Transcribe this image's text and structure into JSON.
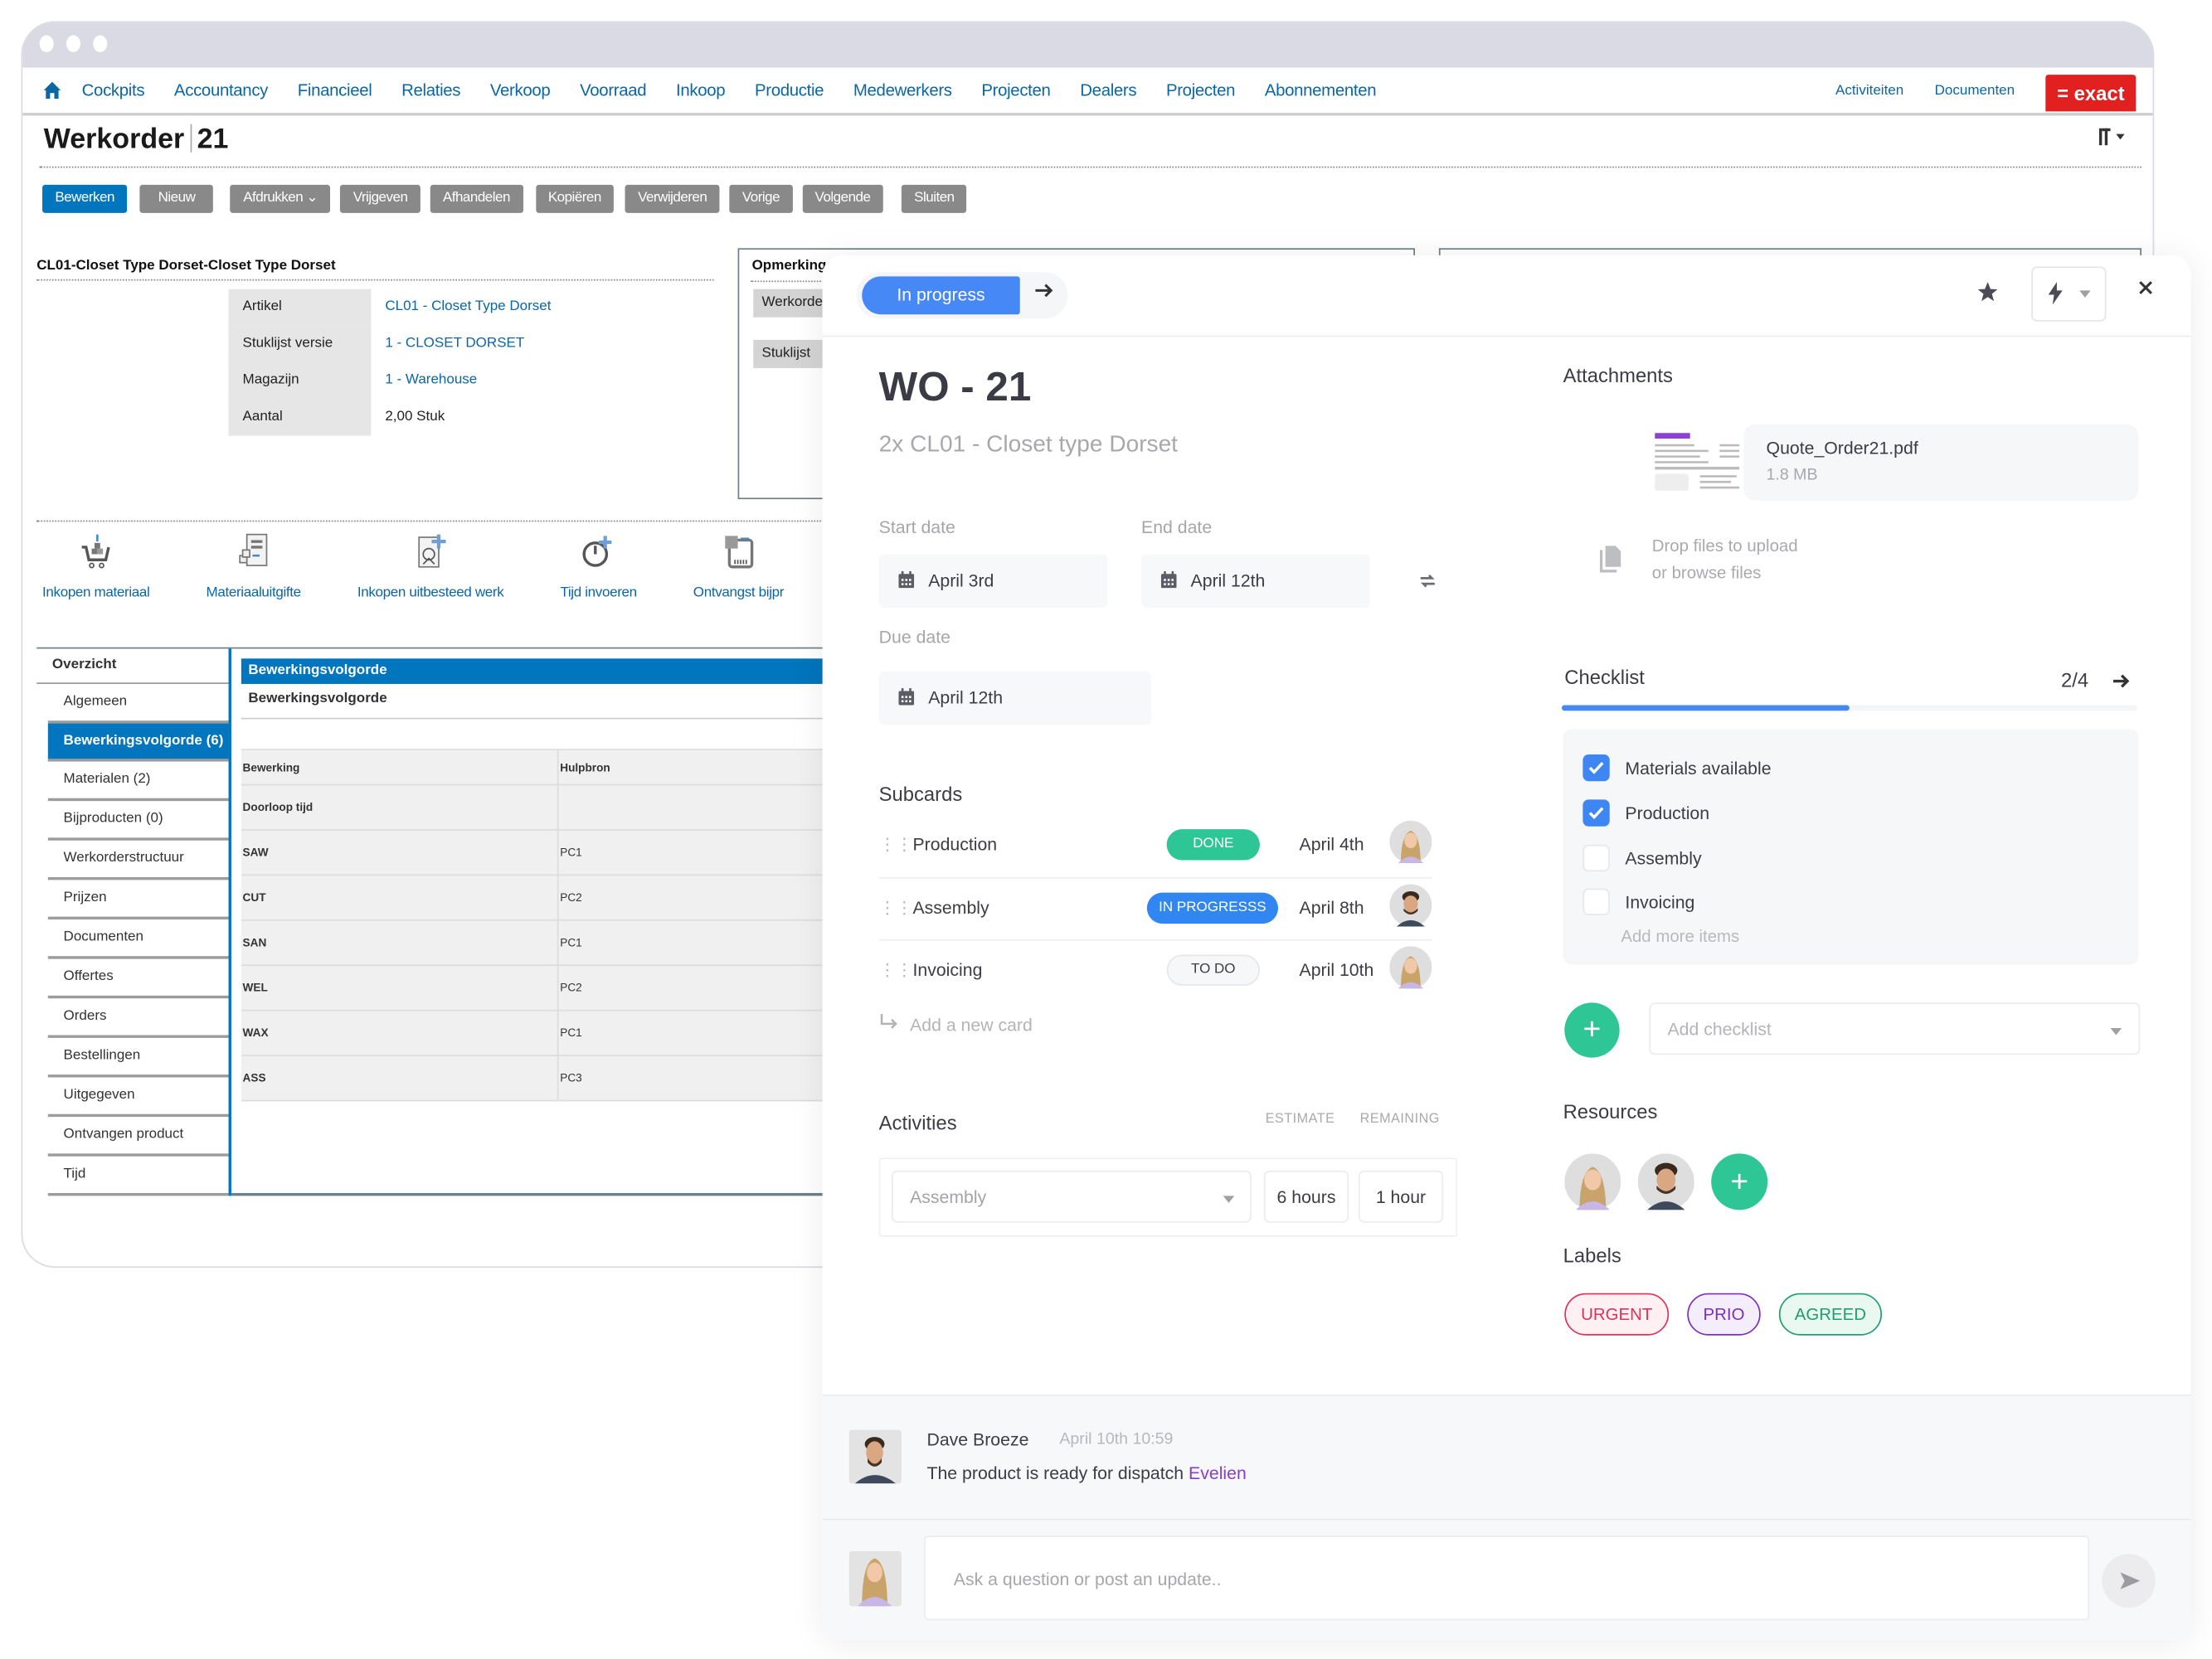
{
  "erp": {
    "nav": {
      "home_icon": "home-icon",
      "items": [
        "Cockpits",
        "Accountancy",
        "Financieel",
        "Relaties",
        "Verkoop",
        "Voorraad",
        "Inkoop",
        "Productie",
        "Medewerkers",
        "Projecten",
        "Dealers",
        "Projecten",
        "Abonnementen"
      ],
      "right_links": [
        "Activiteiten",
        "Documenten"
      ],
      "logo": "= exact"
    },
    "page_title": "Werkorder",
    "page_number": "21",
    "toolbar": [
      "Bewerken",
      "Nieuw",
      "Afdrukken",
      "Vrijgeven",
      "Afhandelen",
      "Kopiëren",
      "Verwijderen",
      "Vorige",
      "Volgende",
      "Sluiten"
    ],
    "section_title": "CL01-Closet Type Dorset-Closet Type Dorset",
    "properties": [
      {
        "label": "Artikel",
        "value": "CL01 - Closet Type Dorset",
        "link": true
      },
      {
        "label": "Stuklijst versie",
        "value": "1 - CLOSET DORSET",
        "link": true
      },
      {
        "label": "Magazijn",
        "value": "1 - Warehouse",
        "link": true
      },
      {
        "label": "Aantal",
        "value": "2,00 Stuk",
        "link": false
      }
    ],
    "remarks": {
      "title": "Opmerking",
      "labels": [
        "Werkorde",
        "Stuklijst"
      ]
    },
    "actions": [
      {
        "label": "Inkopen materiaal",
        "icon": "cart-icon"
      },
      {
        "label": "Materiaaluitgifte",
        "icon": "material-issue-icon"
      },
      {
        "label": "Inkopen uitbesteed werk",
        "icon": "outsourced-work-icon"
      },
      {
        "label": "Tijd invoeren",
        "icon": "stopwatch-icon"
      },
      {
        "label": "Ontvangst bijpr",
        "icon": "receipt-icon"
      }
    ],
    "sidebar": {
      "head": "Overzicht",
      "items": [
        "Algemeen",
        "Bewerkingsvolgorde (6)",
        "Materialen (2)",
        "Bijproducten (0)",
        "Werkorderstructuur",
        "Prijzen",
        "Documenten",
        "Offertes",
        "Orders",
        "Bestellingen",
        "Uitgegeven",
        "Ontvangen product",
        "Tijd"
      ],
      "active_index": 1
    },
    "routing": {
      "header": "Bewerkingsvolgorde",
      "subheader": "Bewerkingsvolgorde",
      "columns": [
        "Bewerking",
        "Hulpbron"
      ],
      "rows": [
        [
          "Doorloop tijd",
          ""
        ],
        [
          "SAW",
          "PC1"
        ],
        [
          "CUT",
          "PC2"
        ],
        [
          "SAN",
          "PC1"
        ],
        [
          "WEL",
          "PC2"
        ],
        [
          "WAX",
          "PC1"
        ],
        [
          "ASS",
          "PC3"
        ]
      ]
    }
  },
  "card": {
    "status": "In progress",
    "title": "WO - 21",
    "subtitle": "2x CL01 - Closet type Dorset",
    "start_label": "Start date",
    "start_value": "April 3rd",
    "end_label": "End date",
    "end_value": "April 12th",
    "due_label": "Due date",
    "due_value": "April 12th",
    "subcards_title": "Subcards",
    "subcards": [
      {
        "name": "Production",
        "status": "DONE",
        "date": "April 4th",
        "assignee": "woman"
      },
      {
        "name": "Assembly",
        "status": "IN PROGRESSS",
        "date": "April 8th",
        "assignee": "man"
      },
      {
        "name": "Invoicing",
        "status": "TO DO",
        "date": "April 10th",
        "assignee": "woman"
      }
    ],
    "add_card": "Add a new card",
    "activities": {
      "title": "Activities",
      "estimate_header": "ESTIMATE",
      "remaining_header": "REMAINING",
      "activity": "Assembly",
      "estimate": "6 hours",
      "remaining": "1 hour"
    },
    "attachments": {
      "title": "Attachments",
      "file_name": "Quote_Order21.pdf",
      "file_size": "1.8 MB",
      "drop_line1": "Drop files to upload",
      "drop_line2": "or browse files"
    },
    "checklist": {
      "title": "Checklist",
      "count": "2/4",
      "progress": 0.5,
      "items": [
        {
          "label": "Materials available",
          "checked": true
        },
        {
          "label": "Production",
          "checked": true
        },
        {
          "label": "Assembly",
          "checked": false
        },
        {
          "label": "Invoicing",
          "checked": false
        }
      ],
      "add_more": "Add more items",
      "add_checklist_placeholder": "Add checklist"
    },
    "resources_title": "Resources",
    "labels_title": "Labels",
    "labels": [
      {
        "text": "URGENT",
        "color": "#e0315a",
        "bg": "#fff0f3"
      },
      {
        "text": "PRIO",
        "color": "#7b2fbf",
        "bg": "#f4eefc"
      },
      {
        "text": "AGREED",
        "color": "#1f9e73",
        "bg": "#e9f9f2"
      }
    ],
    "comment": {
      "author": "Dave Broeze",
      "time": "April 10th 10:59",
      "text": "The product is ready for dispatch",
      "mention": "Evelien"
    },
    "comment_placeholder": "Ask a question or post an update.."
  },
  "colors": {
    "erp_blue": "#0175bd",
    "exact_red": "#e1201f",
    "status_blue": "#4788f7",
    "done_green": "#2fc695"
  }
}
